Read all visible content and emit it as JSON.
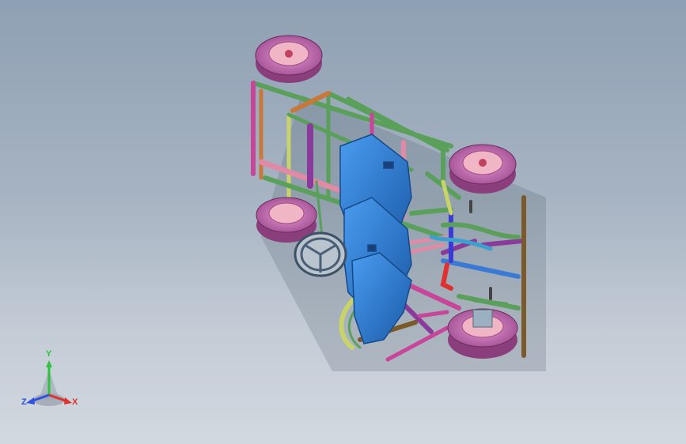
{
  "viewport": {
    "colors": {
      "background_top": "#8ea0b3",
      "background_bottom": "#d2d8df",
      "tire": "#c679b4",
      "tire_tread": "#a85a98",
      "rim": "#f0b6c6",
      "seat": "#2f7fd6",
      "frame_green": "#5aa05a",
      "frame_magenta": "#c8459a",
      "frame_pink": "#e08aa6",
      "frame_orange": "#c8783a",
      "frame_brown": "#7a5a2a",
      "frame_purple": "#8a3a9a",
      "frame_blue": "#3a7ad6",
      "frame_yellow": "#c8d46a",
      "steering_wheel": "#6a7f95"
    }
  },
  "triad": {
    "axis_y_label": "Y",
    "axis_x_label": "X",
    "axis_z_label": "Z",
    "colors": {
      "y": "#2dc43a",
      "x": "#e03030",
      "z": "#3050e0"
    }
  }
}
